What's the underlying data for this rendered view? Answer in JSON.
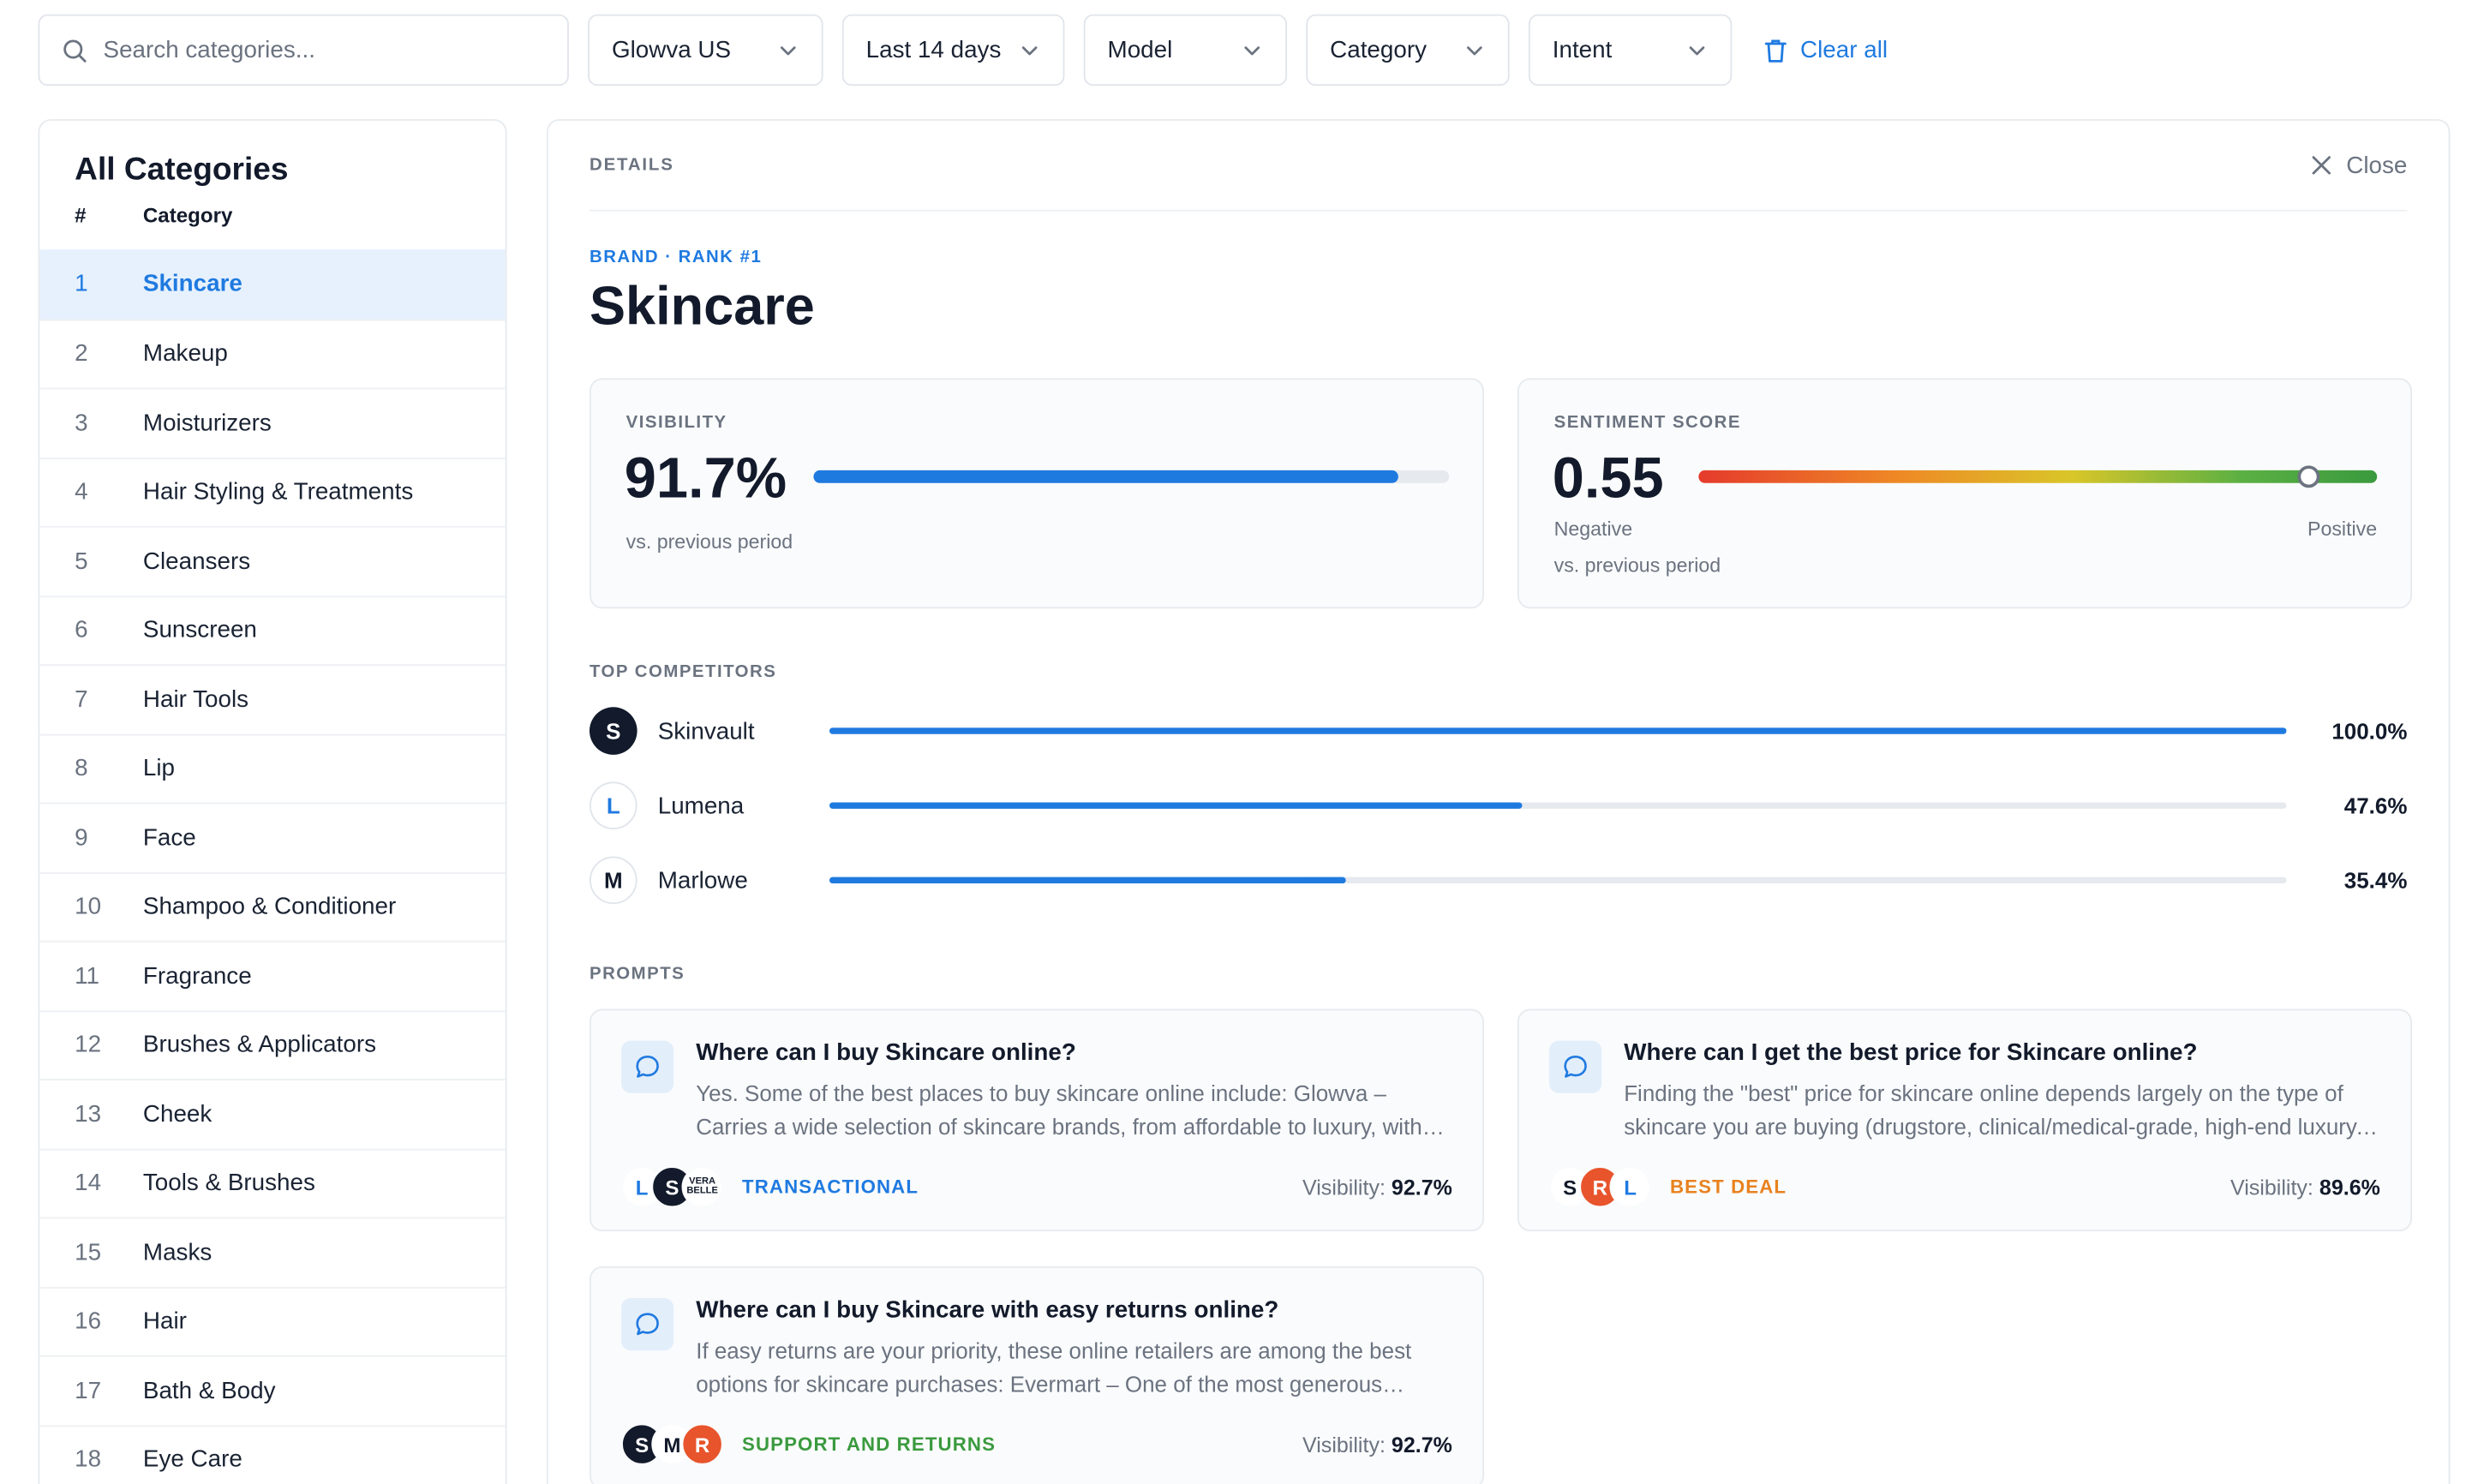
{
  "filters": {
    "search_placeholder": "Search categories...",
    "market": "Glowva US",
    "period": "Last 14 days",
    "model": "Model",
    "category": "Category",
    "intent": "Intent",
    "clear_all": "Clear all"
  },
  "sidebar": {
    "title": "All Categories",
    "col_num": "#",
    "col_category": "Category",
    "active_index": 0,
    "items": [
      {
        "num": "1",
        "label": "Skincare"
      },
      {
        "num": "2",
        "label": "Makeup"
      },
      {
        "num": "3",
        "label": "Moisturizers"
      },
      {
        "num": "4",
        "label": "Hair Styling & Treatments"
      },
      {
        "num": "5",
        "label": "Cleansers"
      },
      {
        "num": "6",
        "label": "Sunscreen"
      },
      {
        "num": "7",
        "label": "Hair Tools"
      },
      {
        "num": "8",
        "label": "Lip"
      },
      {
        "num": "9",
        "label": "Face"
      },
      {
        "num": "10",
        "label": "Shampoo & Conditioner"
      },
      {
        "num": "11",
        "label": "Fragrance"
      },
      {
        "num": "12",
        "label": "Brushes & Applicators"
      },
      {
        "num": "13",
        "label": "Cheek"
      },
      {
        "num": "14",
        "label": "Tools & Brushes"
      },
      {
        "num": "15",
        "label": "Masks"
      },
      {
        "num": "16",
        "label": "Hair"
      },
      {
        "num": "17",
        "label": "Bath & Body"
      },
      {
        "num": "18",
        "label": "Eye Care"
      }
    ]
  },
  "details": {
    "eyebrow": "DETAILS",
    "close_label": "Close",
    "rank_line": "BRAND · RANK #1",
    "title": "Skincare",
    "visibility": {
      "label": "VISIBILITY",
      "value": "91.7%",
      "fraction": 0.917,
      "sub": "vs. previous period"
    },
    "sentiment": {
      "label": "SENTIMENT SCORE",
      "value": "0.55",
      "position": 0.9,
      "negative": "Negative",
      "positive": "Positive",
      "sub": "vs. previous period"
    },
    "competitors_label": "TOP COMPETITORS",
    "competitors": [
      {
        "initial": "S",
        "name": "Skinvault",
        "pct": "100.0%",
        "fraction": 1.0,
        "style": "dark"
      },
      {
        "initial": "L",
        "name": "Lumena",
        "pct": "47.6%",
        "fraction": 0.476,
        "style": "light"
      },
      {
        "initial": "M",
        "name": "Marlowe",
        "pct": "35.4%",
        "fraction": 0.354,
        "style": "plain"
      }
    ],
    "prompts_label": "PROMPTS",
    "prompts": [
      {
        "question": "Where can I buy Skincare online?",
        "answer": "Yes. Some of the best places to buy skincare online include: Glowva – Carries a wide selection of skincare brands, from affordable to luxury, with frequent…",
        "intent": "TRANSACTIONAL",
        "intent_color": "#1f7ae0",
        "visibility_label": "Visibility:",
        "visibility": "92.7%",
        "brands": [
          {
            "text": "L",
            "style": "m-light"
          },
          {
            "text": "S",
            "style": "m-dark"
          },
          {
            "text": "VERA BELLE",
            "style": "m-vb"
          }
        ]
      },
      {
        "question": "Where can I get the best price for Skincare online?",
        "answer": "Finding the \"best\" price for skincare online depends largely on the type of skincare you are buying (drugstore, clinical/medical-grade, high-end luxury, o…",
        "intent": "BEST DEAL",
        "intent_color": "#e8821f",
        "visibility_label": "Visibility:",
        "visibility": "89.6%",
        "brands": [
          {
            "text": "S",
            "style": "m-plain"
          },
          {
            "text": "R",
            "style": "m-red"
          },
          {
            "text": "L",
            "style": "m-light"
          }
        ]
      },
      {
        "question": "Where can I buy Skincare with easy returns online?",
        "answer": "If easy returns are your priority, these online retailers are among the best options for skincare purchases: Evermart – One of the most generous polici…",
        "intent": "SUPPORT AND RETURNS",
        "intent_color": "#3a9a3e",
        "visibility_label": "Visibility:",
        "visibility": "92.7%",
        "brands": [
          {
            "text": "S",
            "style": "m-dark"
          },
          {
            "text": "M",
            "style": "m-plain"
          },
          {
            "text": "R",
            "style": "m-red"
          }
        ]
      }
    ]
  },
  "colors": {
    "accent": "#1f7ae0",
    "active_row_bg": "#e6f1fd",
    "text_dark": "#121a2b",
    "text_muted": "#6b7380"
  }
}
